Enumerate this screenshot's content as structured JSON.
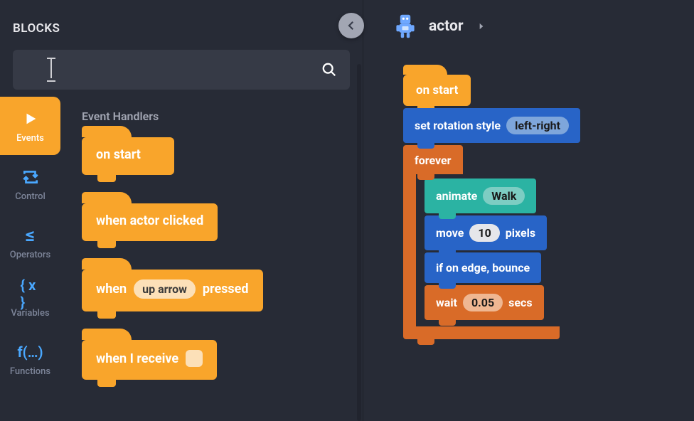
{
  "colors": {
    "event_block": "#f9a52b",
    "blue_block": "#2864c7",
    "orange_block": "#d96b28",
    "teal_block": "#2bb3a3",
    "blue_accent": "#4aa8ff",
    "bg": "#272b36"
  },
  "panel": {
    "title": "BLOCKS",
    "search_placeholder": ""
  },
  "categories": [
    {
      "id": "events",
      "label": "Events",
      "active": true,
      "icon": "play"
    },
    {
      "id": "control",
      "label": "Control",
      "active": false,
      "icon": "loop"
    },
    {
      "id": "operators",
      "label": "Operators",
      "active": false,
      "icon": "lte"
    },
    {
      "id": "variables",
      "label": "Variables",
      "active": false,
      "icon": "braces"
    },
    {
      "id": "functions",
      "label": "Functions",
      "active": false,
      "icon": "fn"
    }
  ],
  "palette": {
    "heading": "Event Handlers",
    "blocks": [
      {
        "id": "on_start",
        "parts": [
          "on start"
        ]
      },
      {
        "id": "actor_click",
        "parts": [
          "when actor clicked"
        ]
      },
      {
        "id": "key_pressed",
        "parts": [
          "when",
          {
            "pill": "up arrow"
          },
          "pressed"
        ]
      },
      {
        "id": "receive",
        "parts": [
          "when I receive",
          {
            "empty": true
          }
        ]
      }
    ]
  },
  "actor": {
    "name": "actor",
    "sprite": "robot"
  },
  "script": {
    "hat": "on start",
    "stack": [
      {
        "type": "blue",
        "parts": [
          "set rotation style",
          {
            "pill": "left-right",
            "style": "blue-light"
          }
        ]
      },
      {
        "type": "forever",
        "label": "forever",
        "body": [
          {
            "type": "teal",
            "parts": [
              "animate",
              {
                "pill": "Walk",
                "style": "teal-light"
              }
            ]
          },
          {
            "type": "blue",
            "parts": [
              "move",
              {
                "pill": "10",
                "style": "round"
              },
              "pixels"
            ]
          },
          {
            "type": "blue",
            "parts": [
              "if on edge, bounce"
            ]
          },
          {
            "type": "orange",
            "parts": [
              "wait",
              {
                "pill": "0.05",
                "style": "orange-light"
              },
              "secs"
            ]
          }
        ]
      }
    ]
  }
}
